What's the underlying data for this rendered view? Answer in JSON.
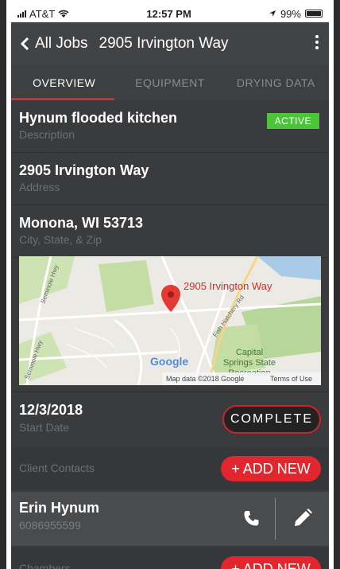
{
  "status_bar": {
    "carrier": "AT&T",
    "time": "12:57 PM",
    "battery": "99%",
    "battery_level": 0.99
  },
  "header": {
    "back_label": "All Jobs",
    "title": "2905 Irvington Way"
  },
  "tabs": [
    {
      "label": "OVERVIEW",
      "active": true
    },
    {
      "label": "EQUIPMENT",
      "active": false
    },
    {
      "label": "DRYING DATA",
      "active": false
    }
  ],
  "fields": {
    "description": {
      "value": "Hynum flooded kitchen",
      "label": "Description",
      "badge": "ACTIVE"
    },
    "address": {
      "value": "2905 Irvington Way",
      "label": "Address"
    },
    "city": {
      "value": "Monona, WI 53713",
      "label": "City, State, & Zip"
    }
  },
  "map": {
    "pin_label": "2905 Irvington Way",
    "road_1": "Seminole Hwy",
    "road_2": "Fish Hatchery Rd",
    "road_3": "Seminole Hwy",
    "park_label_1": "Capital",
    "park_label_2": "Springs State",
    "park_label_3": "Recreation",
    "google_logo": "Google",
    "attribution": "Map data ©2018 Google",
    "terms": "Terms of Use"
  },
  "start": {
    "value": "12/3/2018",
    "label": "Start Date",
    "button": "COMPLETE"
  },
  "client_contacts": {
    "label": "Client Contacts",
    "button": "+ ADD NEW"
  },
  "contact": {
    "name": "Erin Hynum",
    "phone": "6086955599"
  },
  "chambers": {
    "label": "Chambers",
    "button": "+ ADD NEW"
  },
  "colors": {
    "accent": "#e3262d",
    "active_badge": "#4cc43a",
    "background": "#3a3b3d"
  }
}
